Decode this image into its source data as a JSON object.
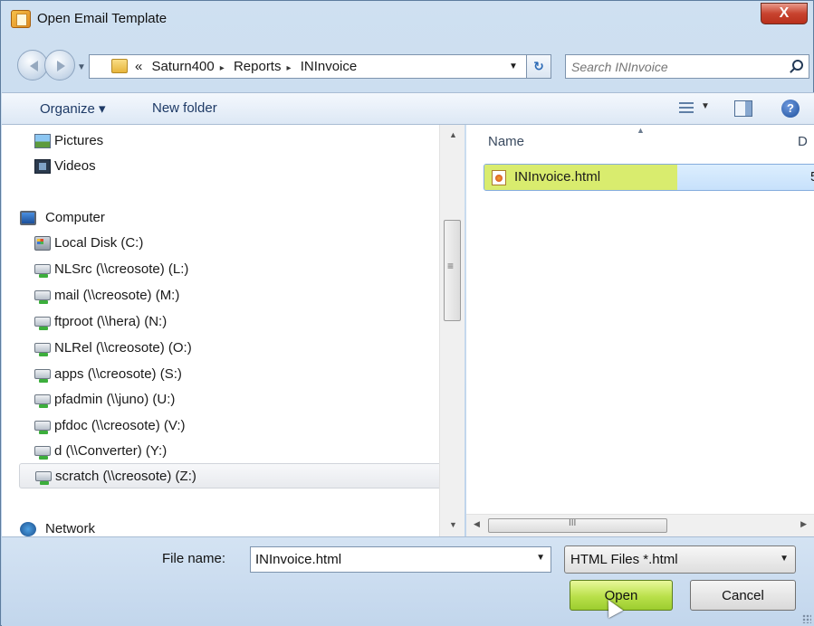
{
  "window": {
    "title": "Open Email Template",
    "close_glyph": "X"
  },
  "address": {
    "overflow": "«",
    "crumbs": [
      "Saturn400",
      "Reports",
      "INInvoice"
    ],
    "separator": "▸",
    "search_placeholder": "Search INInvoice"
  },
  "toolbar": {
    "organize": "Organize ▾",
    "new_folder": "New folder",
    "help_glyph": "?"
  },
  "nav": {
    "pictures": "Pictures",
    "videos": "Videos",
    "computer": "Computer",
    "local_disk": "Local Disk (C:)",
    "nlsrc": "NLSrc (\\\\creosote) (L:)",
    "mail": "mail (\\\\creosote) (M:)",
    "ftproot": "ftproot (\\\\hera) (N:)",
    "nlrel": "NLRel (\\\\creosote) (O:)",
    "apps": "apps (\\\\creosote) (S:)",
    "pfadmin": "pfadmin (\\\\juno) (U:)",
    "pfdoc": "pfdoc (\\\\creosote) (V:)",
    "converter": "d (\\\\Converter) (Y:)",
    "scratch": "scratch (\\\\creosote) (Z:)",
    "network": "Network"
  },
  "files": {
    "col_name": "Name",
    "col_date": "D",
    "items": [
      {
        "name": "INInvoice.html",
        "extra": "5"
      }
    ]
  },
  "bottom": {
    "file_name_label": "File name:",
    "file_name_value": "INInvoice.html",
    "filter": "HTML Files *.html",
    "open": "Open",
    "cancel": "Cancel"
  },
  "colors": {
    "highlight": "#d9ec6e",
    "selection": "#c7e1fb",
    "open_button": "#b9e04a",
    "close_button": "#c8432f"
  }
}
